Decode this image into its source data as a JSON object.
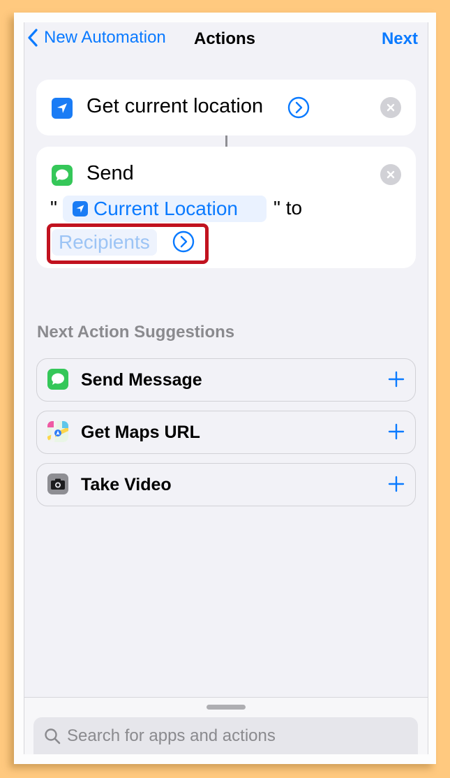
{
  "nav": {
    "back_label": "New Automation",
    "title": "Actions",
    "next_label": "Next"
  },
  "action1": {
    "title": "Get current location",
    "icon": "location-arrow-icon"
  },
  "action2": {
    "title": "Send",
    "quote_open": "\"",
    "variable_label": "Current Location",
    "quote_close_to": "\" to",
    "recipients_placeholder": "Recipients",
    "icon": "messages-icon"
  },
  "suggestions": {
    "heading": "Next Action Suggestions",
    "items": [
      {
        "label": "Send Message",
        "icon": "messages-icon"
      },
      {
        "label": "Get Maps URL",
        "icon": "maps-icon"
      },
      {
        "label": "Take Video",
        "icon": "camera-icon"
      }
    ]
  },
  "search": {
    "placeholder": "Search for apps and actions"
  },
  "colors": {
    "accent": "#0a7aff",
    "highlight": "#c1121f",
    "background": "#ffc97f"
  }
}
